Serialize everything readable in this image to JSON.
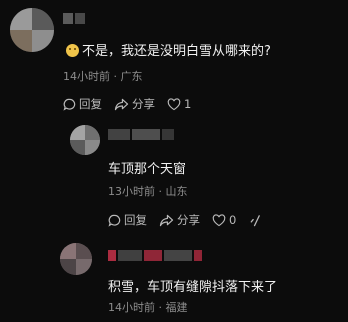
{
  "comments": [
    {
      "text": "不是，我还是没明白雪从哪来的?",
      "meta": "14小时前 · 广东",
      "reply_label": "回复",
      "share_label": "分享",
      "like_count": "1"
    },
    {
      "text": "车顶那个天窗",
      "meta": "13小时前 · 山东",
      "reply_label": "回复",
      "share_label": "分享",
      "like_count": "0"
    },
    {
      "text": "积雪，车顶有缝隙抖落下来了",
      "meta": "14小时前 · 福建"
    }
  ],
  "colors": {
    "background": "#0c0c0c",
    "text": "#f1f1f1",
    "meta": "#8d8d8d",
    "emoji": "#f0c44a",
    "name_highlight": "#c8324a"
  },
  "icons": [
    "smile-emoji-icon",
    "reply-icon",
    "share-icon",
    "heart-icon",
    "more-icon"
  ]
}
